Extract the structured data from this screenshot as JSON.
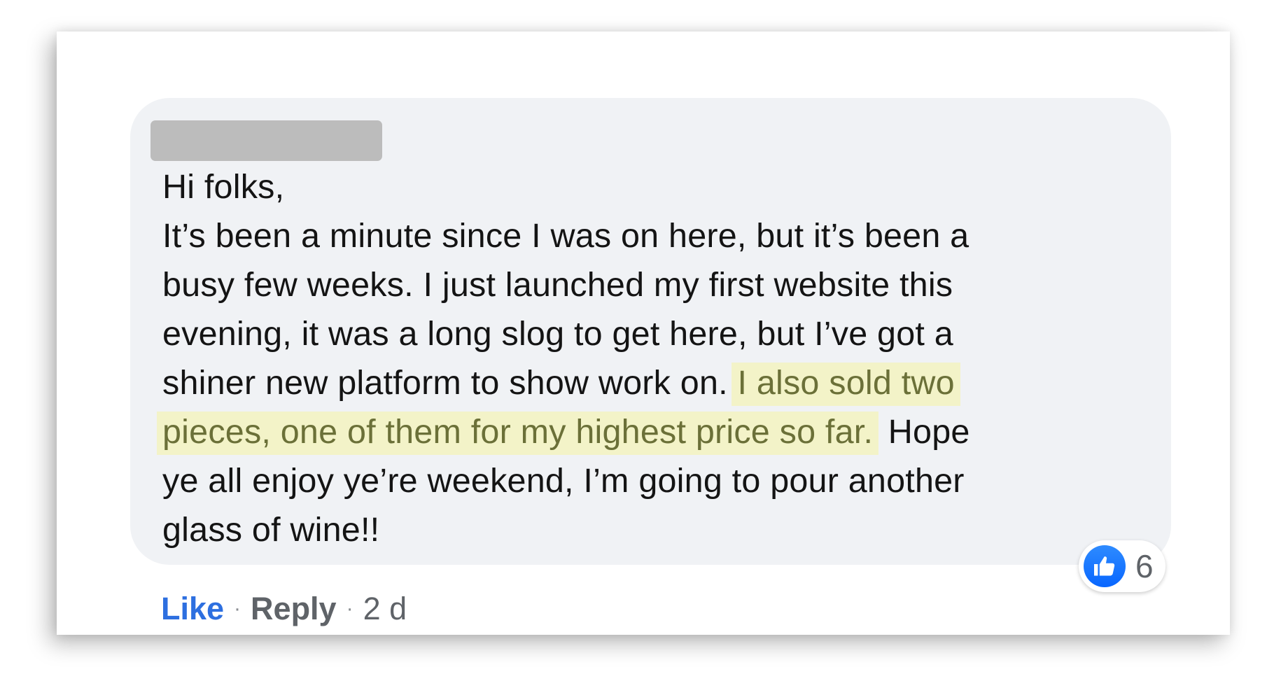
{
  "comment": {
    "lines": [
      {
        "text": "Hi folks,"
      },
      {
        "text": "It’s been a minute since I was on here, but it’s been a"
      },
      {
        "text": "busy few weeks. I just launched my first website this"
      },
      {
        "text": "evening, it was a long slog to get here, but I’ve got a"
      },
      {
        "pre": "shiner new platform to show work on. ",
        "highlight": "I also sold two"
      },
      {
        "highlight": "pieces, one of them for my highest price so far.",
        "post": " Hope"
      },
      {
        "text": "ye all enjoy ye’re weekend, I’m going to pour another"
      },
      {
        "text": "glass of wine!!"
      }
    ]
  },
  "reactions": {
    "icon": "thumbs-up-icon",
    "count": "6",
    "badge_color": "#0866ff"
  },
  "actions": {
    "like_label": "Like",
    "separator": "·",
    "reply_label": "Reply",
    "timestamp": "2 d"
  },
  "colors": {
    "highlight_bg": "#f3f3c8",
    "highlight_text": "#6b7038",
    "bubble_bg": "#f0f2f5",
    "like_link": "#2d6fe0"
  }
}
